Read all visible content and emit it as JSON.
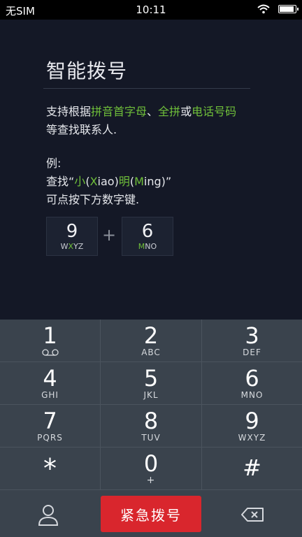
{
  "status_bar": {
    "carrier": "无SIM",
    "time": "10:11"
  },
  "guide": {
    "title": "智能拨号",
    "line1": {
      "a": "支持根据",
      "b": "拼音首字母",
      "c": "、",
      "d": "全拼",
      "e": "或",
      "f": "电话号码"
    },
    "line2": "等查找联系人.",
    "line3": "例:",
    "line4": {
      "a": "查找“",
      "b": "小",
      "c": "(",
      "d": "X",
      "e": "iao",
      "f": ")",
      "g": "明",
      "h": "(",
      "i": "M",
      "j": "ing",
      "k": ")”"
    },
    "line5": "可点按下方数字键.",
    "example_keys": [
      {
        "digit": "9",
        "letters_pre": "W",
        "letters_hl": "X",
        "letters_post": "YZ"
      },
      {
        "digit": "6",
        "letters_pre": "",
        "letters_hl": "M",
        "letters_post": "NO"
      }
    ],
    "plus": "+",
    "highlight_color": "#6fbf3a"
  },
  "keypad": {
    "keys": [
      {
        "digit": "1",
        "sub": ""
      },
      {
        "digit": "2",
        "sub": "ABC"
      },
      {
        "digit": "3",
        "sub": "DEF"
      },
      {
        "digit": "4",
        "sub": "GHI"
      },
      {
        "digit": "5",
        "sub": "JKL"
      },
      {
        "digit": "6",
        "sub": "MNO"
      },
      {
        "digit": "7",
        "sub": "PQRS"
      },
      {
        "digit": "8",
        "sub": "TUV"
      },
      {
        "digit": "9",
        "sub": "WXYZ"
      },
      {
        "digit": "*",
        "sub": ""
      },
      {
        "digit": "0",
        "sub": "+"
      },
      {
        "digit": "#",
        "sub": ""
      }
    ],
    "voicemail_icon": "voicemail-icon"
  },
  "bottom_bar": {
    "contacts_icon": "person-icon",
    "emergency_label": "紧急拨号",
    "emergency_color": "#d9262d",
    "delete_icon": "backspace-icon"
  }
}
